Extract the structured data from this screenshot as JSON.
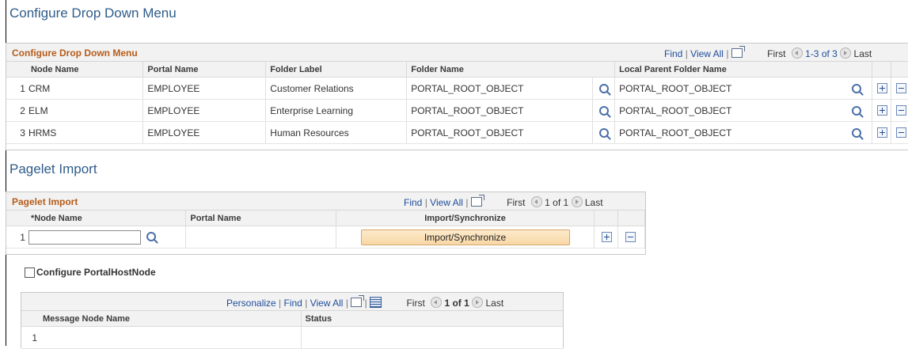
{
  "page_title": "Configure Drop Down Menu",
  "dropdown_grid": {
    "title": "Configure Drop Down Menu",
    "nav": {
      "find": "Find",
      "view_all": "View All",
      "first": "First",
      "range": "1-3 of 3",
      "last": "Last"
    },
    "columns": [
      "Node Name",
      "Portal Name",
      "Folder Label",
      "Folder Name",
      "Local Parent Folder Name"
    ],
    "rows": [
      {
        "num": "1",
        "node": "CRM",
        "portal": "EMPLOYEE",
        "label": "Customer Relations",
        "folder": "PORTAL_ROOT_OBJECT",
        "parent": "PORTAL_ROOT_OBJECT"
      },
      {
        "num": "2",
        "node": "ELM",
        "portal": "EMPLOYEE",
        "label": "Enterprise Learning",
        "folder": "PORTAL_ROOT_OBJECT",
        "parent": "PORTAL_ROOT_OBJECT"
      },
      {
        "num": "3",
        "node": "HRMS",
        "portal": "EMPLOYEE",
        "label": "Human Resources",
        "folder": "PORTAL_ROOT_OBJECT",
        "parent": "PORTAL_ROOT_OBJECT"
      }
    ]
  },
  "pagelet_section_title": "Pagelet Import",
  "pagelet_grid": {
    "title": "Pagelet Import",
    "nav": {
      "find": "Find",
      "view_all": "View All",
      "first": "First",
      "range": "1 of 1",
      "last": "Last"
    },
    "columns": [
      "*Node Name",
      "Portal Name",
      "Import/Synchronize"
    ],
    "row": {
      "num": "1",
      "node_value": "",
      "button_label": "Import/Synchronize"
    }
  },
  "configure_portalhost": {
    "label": "Configure PortalHostNode",
    "checked": false
  },
  "message_grid": {
    "nav": {
      "personalize": "Personalize",
      "find": "Find",
      "view_all": "View All",
      "first": "First",
      "range": "1 of 1",
      "last": "Last"
    },
    "columns": [
      "Message Node Name",
      "Status"
    ],
    "row": {
      "num": "1"
    }
  }
}
